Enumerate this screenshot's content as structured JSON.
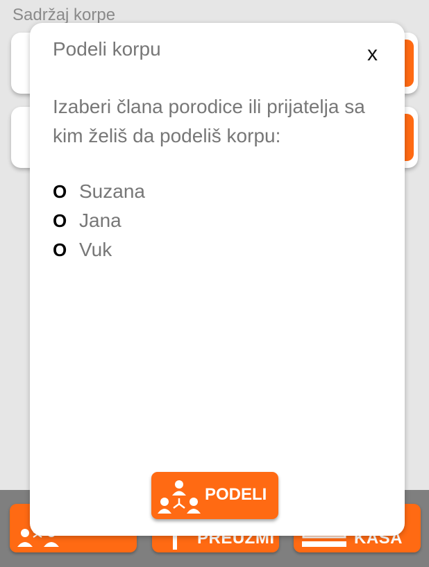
{
  "background": {
    "title": "Sadržaj korpe",
    "bottom_buttons": [
      {
        "label": ""
      },
      {
        "label": "PREUZMI"
      },
      {
        "label": "KASA"
      }
    ]
  },
  "modal": {
    "title": "Podeli korpu",
    "close_label": "x",
    "instruction": "Izaberi člana porodice ili prijatelja sa kim želiš da podeliš korpu:",
    "radio_symbol": "O",
    "options": [
      "Suzana",
      "Jana",
      "Vuk"
    ],
    "share_button_label": "PODELI"
  },
  "colors": {
    "accent": "#ff6a13",
    "text_gray": "#777777",
    "background": "#e6e6e6",
    "bottom_bar": "#7f7f7f"
  },
  "icons": {
    "share": "people-share-icon",
    "close": "close-icon",
    "download": "download-icon",
    "cash_register": "cash-register-icon"
  }
}
